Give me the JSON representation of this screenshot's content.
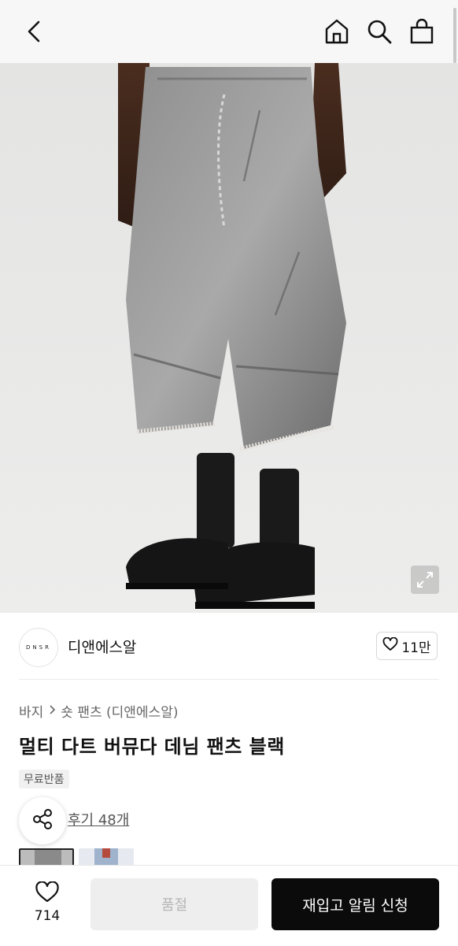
{
  "header": {
    "icons": [
      "back-icon",
      "home-icon",
      "search-icon",
      "shopping-bag-icon"
    ]
  },
  "hero": {
    "expand_icon": "expand-icon"
  },
  "brand": {
    "logo_text": "DNSR",
    "name": "디앤에스알",
    "like_count": "11만"
  },
  "breadcrumb": {
    "category": "바지",
    "subcategory": "숏 팬츠 (디앤에스알)"
  },
  "product": {
    "title": "멀티 다트 버뮤다 데님 팬츠 블랙",
    "badge": "무료반품",
    "review_link": "후기 48개"
  },
  "bottom_bar": {
    "wish_count": "714",
    "soldout_label": "품절",
    "restock_label": "재입고 알림 신청"
  },
  "colors": {
    "accent_dark": "#0b0b0b",
    "disabled_bg": "#eeeeee",
    "disabled_text": "#b5b5b5"
  }
}
